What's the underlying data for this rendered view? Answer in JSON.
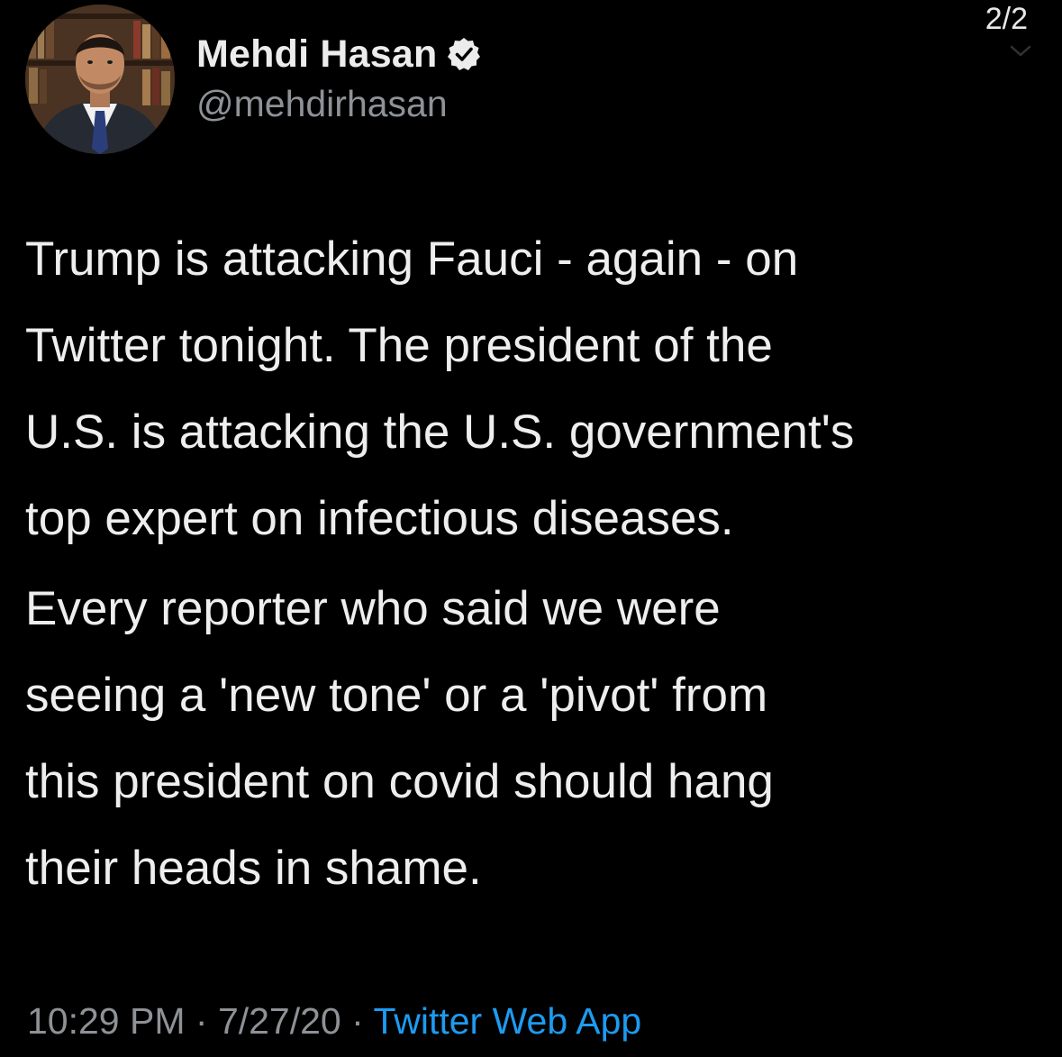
{
  "tweet": {
    "counter": "2/2",
    "author": {
      "display_name": "Mehdi Hasan",
      "handle": "@mehdirhasan",
      "verified": true,
      "avatar_icon": "profile-photo"
    },
    "paragraphs": [
      "Trump is attacking Fauci - again - on\nTwitter tonight. The president of the\nU.S. is attacking the U.S. government's\ntop expert on infectious diseases.",
      "Every reporter who said we were\nseeing a 'new tone' or a 'pivot' from\nthis president on covid should hang\ntheir heads in shame."
    ],
    "meta": {
      "time": "10:29 PM",
      "separator": " · ",
      "date": "7/27/20",
      "source": "Twitter Web App"
    }
  },
  "colors": {
    "background": "#000000",
    "text": "#eeeeee",
    "muted": "#8e9297",
    "link": "#1d9bf0"
  }
}
